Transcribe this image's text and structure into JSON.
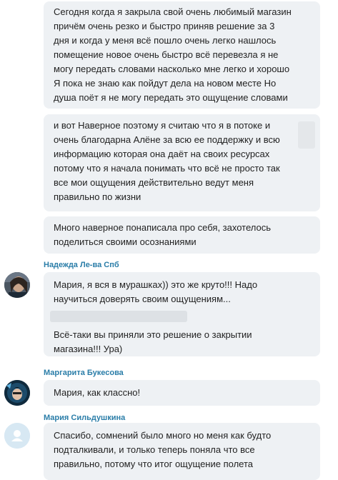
{
  "messages": [
    {
      "lines": [
        "Сегодня когда я закрыла свой очень любимый магазин",
        "причём очень резко и быстро приняв решение за 3",
        "дня и когда у меня всё пошло очень легко нашлось",
        "помещение новое очень быстро всё перевезла я не",
        "могу передать словами насколько мне легко и хорошо",
        "Я пока не знаю как пойдут дела на новом месте Но",
        "душа поёт я не могу передать это ощущение словами"
      ]
    },
    {
      "lines": [
        "и вот Наверное поэтому я считаю что я в потоке и",
        "очень благодарна Алёне за всю ее поддержку и всю",
        "информацию которая она даёт на своих ресурсах",
        "потому что я начала понимать что всё не просто так",
        "все мои ощущения действительно ведут меня",
        "правильно по жизни"
      ]
    },
    {
      "lines": [
        "Много наверное понаписала про себя, захотелось",
        "поделиться своими осознаниями"
      ]
    },
    {
      "author": "Надежда Ле-ва Спб",
      "lines_a": [
        "Мария, я вся в мурашках)) это же круто!!! Надо",
        "научиться доверять своим ощущениям..."
      ],
      "lines_b": [
        "Всё-таки вы приняли это решение о закрытии",
        "магазина!!! Ура)"
      ]
    },
    {
      "author": "Маргарита Букесова",
      "lines": [
        "Мария, как классно!"
      ]
    },
    {
      "author": "Мария Сильдушкина",
      "lines": [
        "Спасибо, сомнений было много но меня как будто",
        "подталкивали, и только теперь поняла что все",
        "правильно, потому что итог ощущение полета"
      ]
    }
  ],
  "colors": {
    "bubble": "#eef1f4",
    "author": "#2a7da8",
    "text": "#222222",
    "placeholder_avatar": "#d7e8f3"
  },
  "icons": {
    "default_avatar": "user-silhouette-icon"
  }
}
